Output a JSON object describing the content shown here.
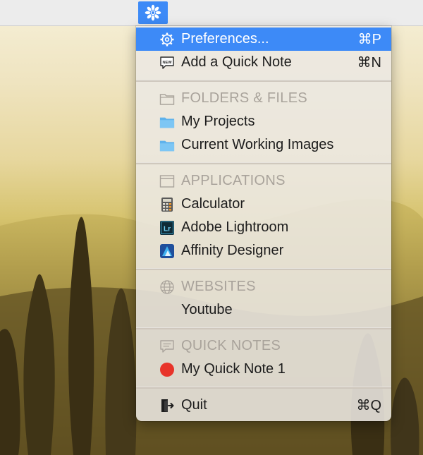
{
  "menu": {
    "items": [
      {
        "label": "Preferences...",
        "shortcut": "⌘P"
      },
      {
        "label": "Add a Quick Note",
        "shortcut": "⌘N"
      },
      {
        "label": "FOLDERS & FILES"
      },
      {
        "label": "My Projects"
      },
      {
        "label": "Current Working Images"
      },
      {
        "label": "APPLICATIONS"
      },
      {
        "label": "Calculator"
      },
      {
        "label": "Adobe Lightroom"
      },
      {
        "label": "Affinity Designer"
      },
      {
        "label": "WEBSITES"
      },
      {
        "label": "Youtube"
      },
      {
        "label": "QUICK NOTES"
      },
      {
        "label": "My Quick Note 1"
      },
      {
        "label": "Quit",
        "shortcut": "⌘Q"
      }
    ],
    "icon_names": {
      "preferences": "gear-icon",
      "quick_note": "new-note-icon",
      "folders_header": "folder-outline-icon",
      "folder": "folder-icon",
      "applications_header": "window-icon",
      "calculator": "calculator-app-icon",
      "lightroom": "lightroom-app-icon",
      "affinity": "affinity-designer-app-icon",
      "websites_header": "globe-icon",
      "quick_notes_header": "speech-bubble-icon",
      "note_marker": "red-dot-icon",
      "quit": "exit-door-icon"
    },
    "lightroom_icon_text": "Lr",
    "note_icon_text": "NEW"
  },
  "colors": {
    "highlight": "#3d8af7",
    "header_text": "#a9a39b",
    "note_dot": "#e8342a",
    "folder_blue": "#63b8f1"
  }
}
